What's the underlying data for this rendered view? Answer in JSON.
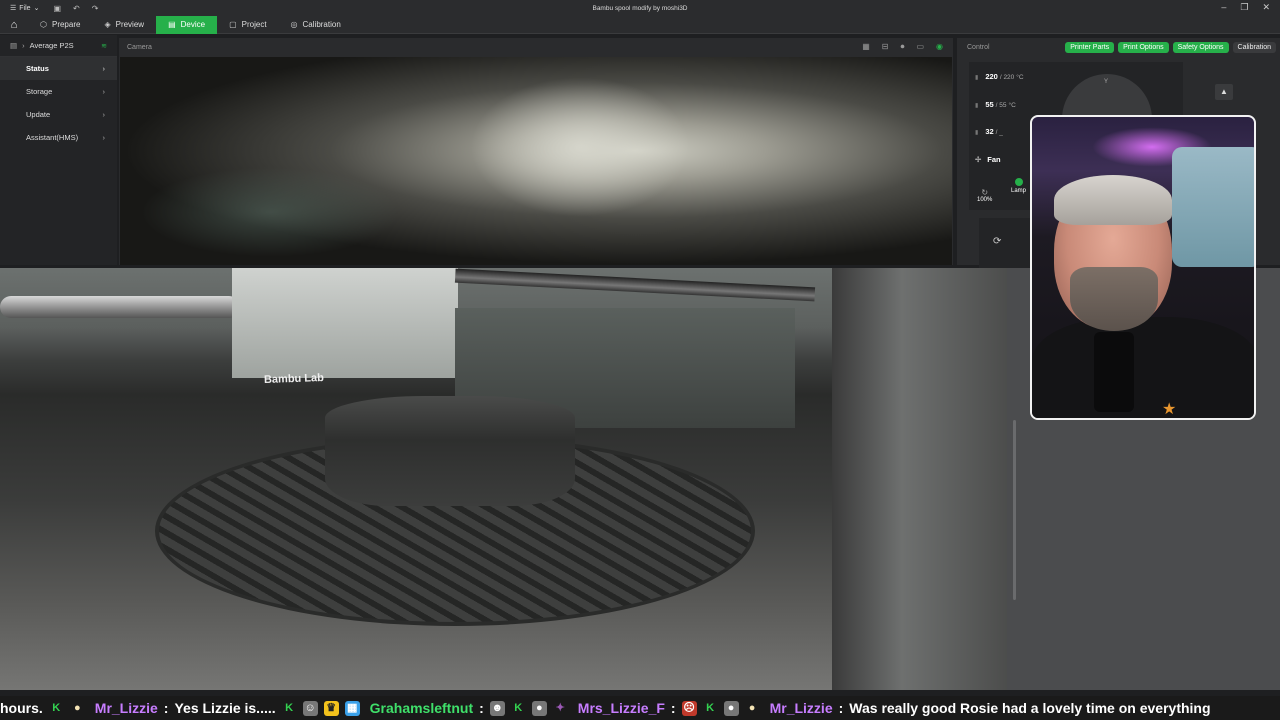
{
  "titlebar": {
    "menu_label": "File",
    "window_title": "Bambu spool modify by moshi3D"
  },
  "nav": {
    "tabs": [
      {
        "label": "Prepare",
        "icon": "cube-icon"
      },
      {
        "label": "Preview",
        "icon": "layers-icon"
      },
      {
        "label": "Device",
        "icon": "printer-icon",
        "active": true
      },
      {
        "label": "Project",
        "icon": "folder-icon"
      },
      {
        "label": "Calibration",
        "icon": "target-icon"
      }
    ]
  },
  "sidebar": {
    "printer_name": "Average P2S",
    "items": [
      {
        "label": "Status",
        "active": true
      },
      {
        "label": "Storage"
      },
      {
        "label": "Update"
      },
      {
        "label": "Assistant(HMS)"
      }
    ]
  },
  "camera": {
    "header_label": "Camera"
  },
  "control": {
    "header_label": "Control",
    "buttons": [
      "Printer Parts",
      "Print Options",
      "Safety Options",
      "Calibration"
    ],
    "nozzle_temp": {
      "current": "220",
      "target": "/ 220",
      "unit": "°C"
    },
    "bed_temp": {
      "current": "55",
      "target": "/ 55",
      "unit": "°C"
    },
    "chamber_temp": {
      "current": "32",
      "target": "/ _"
    },
    "fan_label": "Fan",
    "speed_value": "100%",
    "lamp_label": "Lamp",
    "dial_axis_label": "Y"
  },
  "printer_photo": {
    "brand_text": "Bambu Lab"
  },
  "ticker": {
    "prefix": "hours.",
    "messages": [
      {
        "user": "Mr_Lizzie",
        "text": "Yes Lizzie is.....",
        "color": "purple"
      },
      {
        "user": "Grahamsleftnut",
        "text": "",
        "color": "green"
      },
      {
        "user": "Mrs_Lizzie_F",
        "text": "",
        "color": "purple"
      },
      {
        "user": "Mr_Lizzie",
        "text": "Was really good Rosie had a lovely time on everything",
        "color": "purple"
      }
    ]
  },
  "colors": {
    "accent": "#26b04a",
    "background": "#1e1f21",
    "panel": "#2a2b2d"
  }
}
